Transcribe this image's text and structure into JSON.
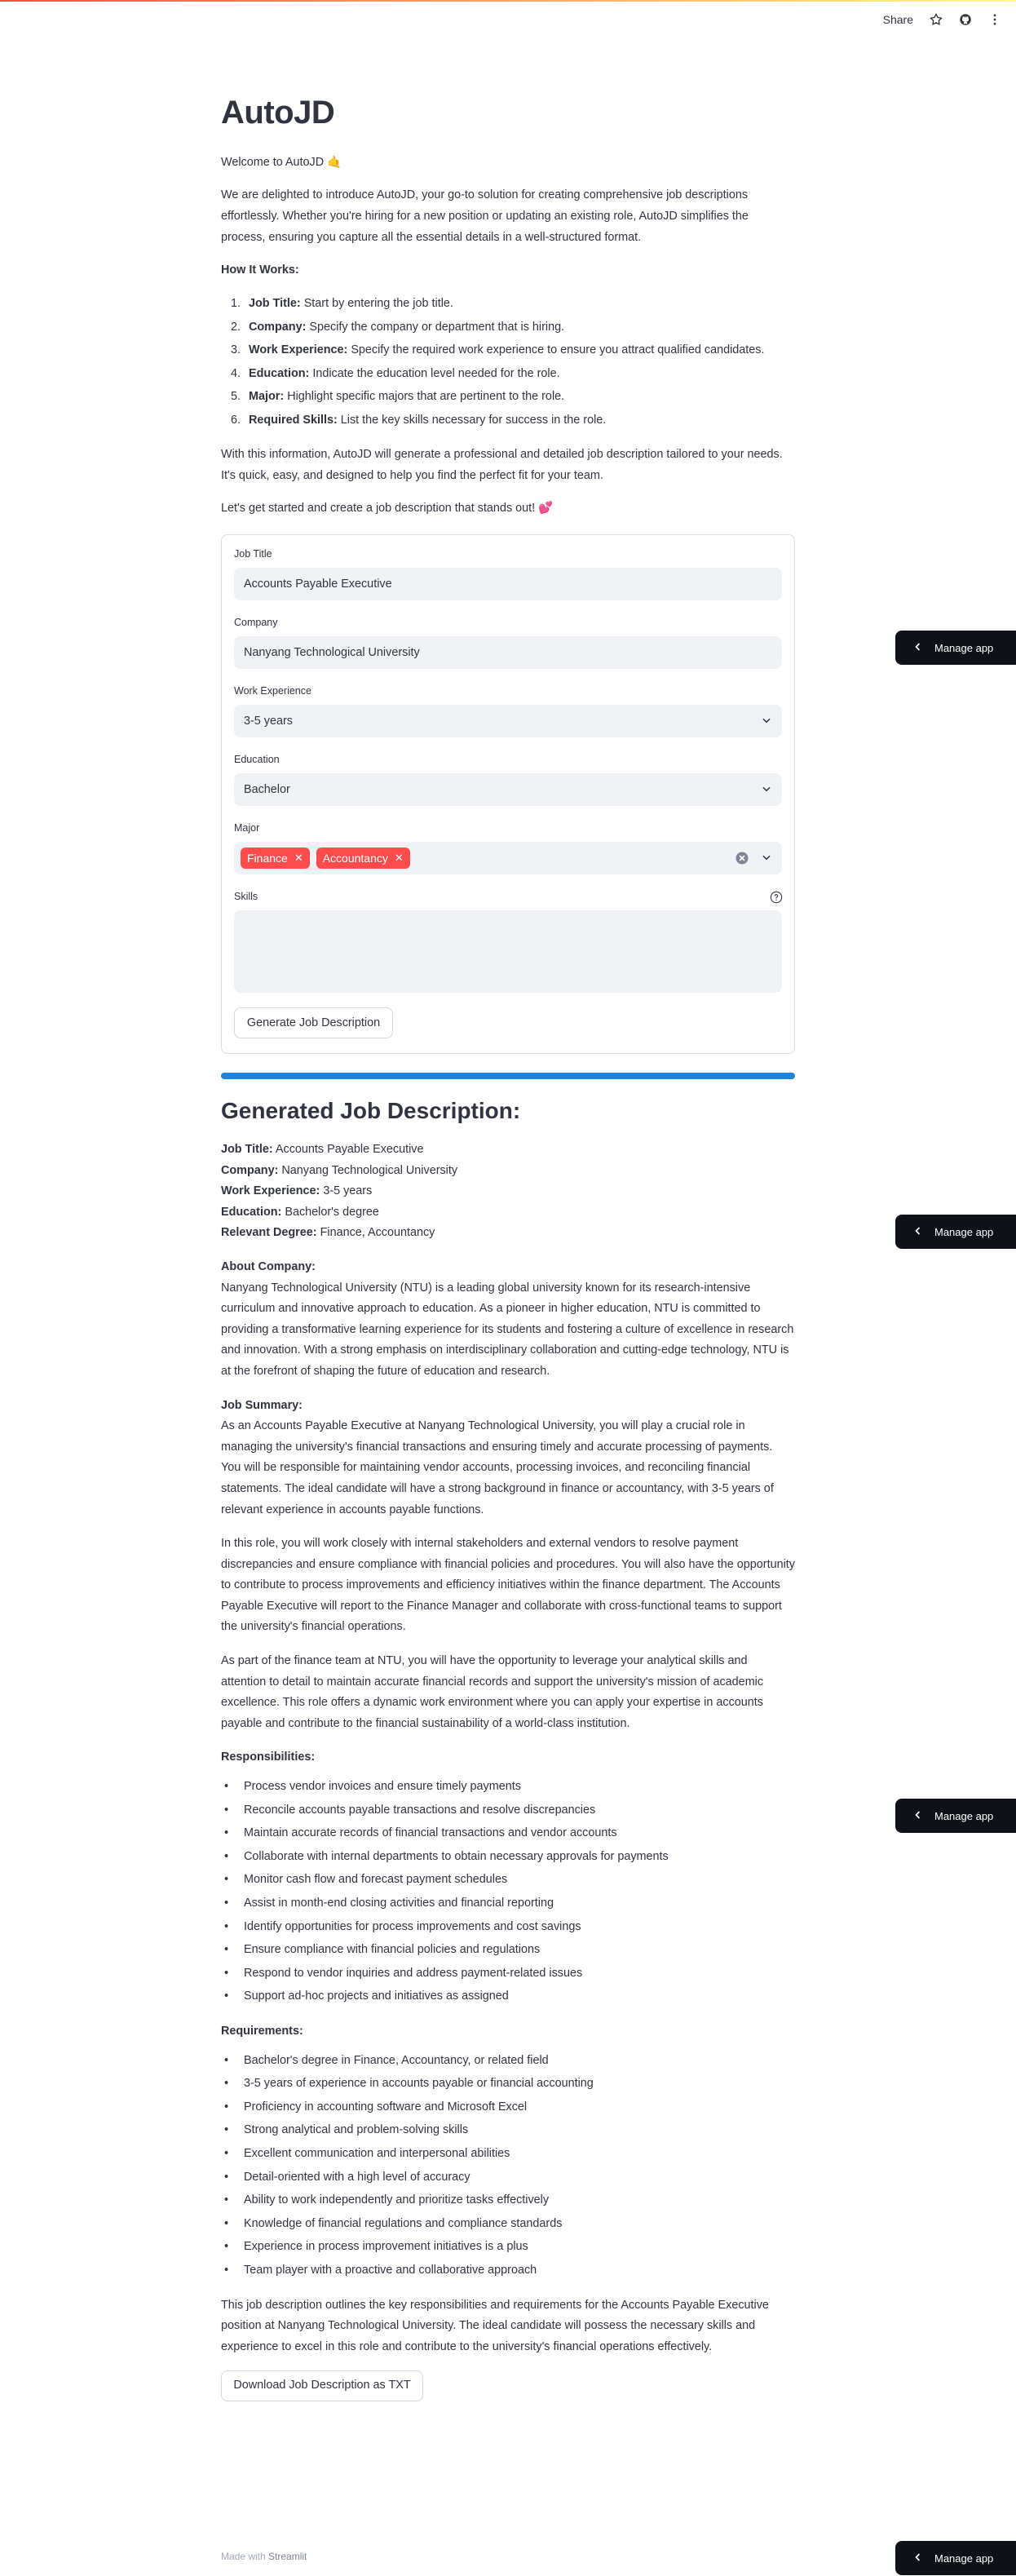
{
  "toolbar": {
    "share_label": "Share",
    "icons": [
      "star-icon",
      "github-icon",
      "kebab-menu-icon"
    ]
  },
  "header": {
    "title": "AutoJD"
  },
  "intro": {
    "welcome": "Welcome to AutoJD 🤙",
    "description": "We are delighted to introduce AutoJD, your go-to solution for creating comprehensive job descriptions effortlessly. Whether you're hiring for a new position or updating an existing role, AutoJD simplifies the process, ensuring you capture all the essential details in a well-structured format.",
    "how_it_works_heading": "How It Works:",
    "steps": [
      {
        "num": "1.",
        "label": "Job Title:",
        "text": "Start by entering the job title."
      },
      {
        "num": "2.",
        "label": "Company:",
        "text": "Specify the company or department that is hiring."
      },
      {
        "num": "3.",
        "label": "Work Experience:",
        "text": "Specify the required work experience to ensure you attract qualified candidates."
      },
      {
        "num": "4.",
        "label": "Education:",
        "text": "Indicate the education level needed for the role."
      },
      {
        "num": "5.",
        "label": "Major:",
        "text": "Highlight specific majors that are pertinent to the role."
      },
      {
        "num": "6.",
        "label": "Required Skills:",
        "text": "List the key skills necessary for success in the role."
      }
    ],
    "closing": "With this information, AutoJD will generate a professional and detailed job description tailored to your needs. It's quick, easy, and designed to help you find the perfect fit for your team.",
    "cta": "Let's get started and create a job description that stands out! 💕"
  },
  "form": {
    "job_title": {
      "label": "Job Title",
      "value": "Accounts Payable Executive"
    },
    "company": {
      "label": "Company",
      "value": "Nanyang Technological University"
    },
    "work_experience": {
      "label": "Work Experience",
      "value": "3-5 years"
    },
    "education": {
      "label": "Education",
      "value": "Bachelor"
    },
    "major": {
      "label": "Major",
      "tags": [
        "Finance",
        "Accountancy"
      ]
    },
    "skills": {
      "label": "Skills",
      "value": ""
    },
    "generate_button": "Generate Job Description"
  },
  "progress": {
    "value": 1.0
  },
  "output": {
    "heading": "Generated Job Description:",
    "summary_lines": [
      {
        "label": "Job Title:",
        "value": "Accounts Payable Executive"
      },
      {
        "label": "Company:",
        "value": "Nanyang Technological University"
      },
      {
        "label": "Work Experience:",
        "value": "3-5 years"
      },
      {
        "label": "Education:",
        "value": "Bachelor's degree"
      },
      {
        "label": "Relevant Degree:",
        "value": "Finance, Accountancy"
      }
    ],
    "about_heading": "About Company:",
    "about_text": "Nanyang Technological University (NTU) is a leading global university known for its research-intensive curriculum and innovative approach to education. As a pioneer in higher education, NTU is committed to providing a transformative learning experience for its students and fostering a culture of excellence in research and innovation. With a strong emphasis on interdisciplinary collaboration and cutting-edge technology, NTU is at the forefront of shaping the future of education and research.",
    "summary_heading": "Job Summary:",
    "summary_p1": "As an Accounts Payable Executive at Nanyang Technological University, you will play a crucial role in managing the university's financial transactions and ensuring timely and accurate processing of payments. You will be responsible for maintaining vendor accounts, processing invoices, and reconciling financial statements. The ideal candidate will have a strong background in finance or accountancy, with 3-5 years of relevant experience in accounts payable functions.",
    "summary_p2": "In this role, you will work closely with internal stakeholders and external vendors to resolve payment discrepancies and ensure compliance with financial policies and procedures. You will also have the opportunity to contribute to process improvements and efficiency initiatives within the finance department. The Accounts Payable Executive will report to the Finance Manager and collaborate with cross-functional teams to support the university's financial operations.",
    "summary_p3": "As part of the finance team at NTU, you will have the opportunity to leverage your analytical skills and attention to detail to maintain accurate financial records and support the university's mission of academic excellence. This role offers a dynamic work environment where you can apply your expertise in accounts payable and contribute to the financial sustainability of a world-class institution.",
    "responsibilities_heading": "Responsibilities:",
    "responsibilities": [
      "Process vendor invoices and ensure timely payments",
      "Reconcile accounts payable transactions and resolve discrepancies",
      "Maintain accurate records of financial transactions and vendor accounts",
      "Collaborate with internal departments to obtain necessary approvals for payments",
      "Monitor cash flow and forecast payment schedules",
      "Assist in month-end closing activities and financial reporting",
      "Identify opportunities for process improvements and cost savings",
      "Ensure compliance with financial policies and regulations",
      "Respond to vendor inquiries and address payment-related issues",
      "Support ad-hoc projects and initiatives as assigned"
    ],
    "requirements_heading": "Requirements:",
    "requirements": [
      "Bachelor's degree in Finance, Accountancy, or related field",
      "3-5 years of experience in accounts payable or financial accounting",
      "Proficiency in accounting software and Microsoft Excel",
      "Strong analytical and problem-solving skills",
      "Excellent communication and interpersonal abilities",
      "Detail-oriented with a high level of accuracy",
      "Ability to work independently and prioritize tasks effectively",
      "Knowledge of financial regulations and compliance standards",
      "Experience in process improvement initiatives is a plus",
      "Team player with a proactive and collaborative approach"
    ],
    "closing": "This job description outlines the key responsibilities and requirements for the Accounts Payable Executive position at Nanyang Technological University. The ideal candidate will possess the necessary skills and experience to excel in this role and contribute to the university's financial operations effectively.",
    "download_button": "Download Job Description as TXT"
  },
  "footer": {
    "made_with": "Made with",
    "brand": "Streamlit"
  },
  "manage_app": {
    "label": "Manage app"
  }
}
